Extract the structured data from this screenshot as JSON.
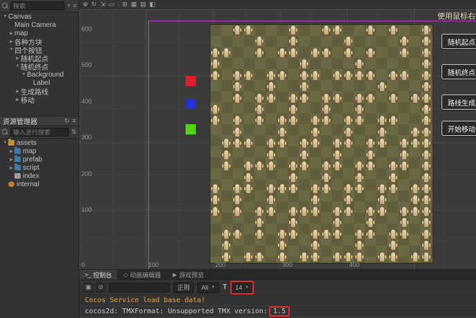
{
  "hierarchy": {
    "search_placeholder": "搜索",
    "items": [
      {
        "label": "Canvas",
        "depth": 0,
        "arrow": "down"
      },
      {
        "label": "Main Camera",
        "depth": 1,
        "arrow": "none"
      },
      {
        "label": "map",
        "depth": 1,
        "arrow": "right"
      },
      {
        "label": "各种方块",
        "depth": 1,
        "arrow": "right"
      },
      {
        "label": "四个按钮",
        "depth": 1,
        "arrow": "down"
      },
      {
        "label": "随机起点",
        "depth": 2,
        "arrow": "right"
      },
      {
        "label": "随机终点",
        "depth": 2,
        "arrow": "down"
      },
      {
        "label": "Background",
        "depth": 3,
        "arrow": "down"
      },
      {
        "label": "Label",
        "depth": 4,
        "arrow": "none"
      },
      {
        "label": "生成路线",
        "depth": 2,
        "arrow": "right"
      },
      {
        "label": "移动",
        "depth": 2,
        "arrow": "right"
      }
    ]
  },
  "assets": {
    "panel_title": "资源管理器",
    "search_placeholder": "输入进行搜索",
    "items": [
      {
        "label": "assets",
        "depth": 0,
        "arrow": "down",
        "icon": "folder-root"
      },
      {
        "label": "map",
        "depth": 1,
        "arrow": "right",
        "icon": "folder"
      },
      {
        "label": "prefab",
        "depth": 1,
        "arrow": "right",
        "icon": "folder"
      },
      {
        "label": "script",
        "depth": 1,
        "arrow": "right",
        "icon": "folder"
      },
      {
        "label": "index",
        "depth": 1,
        "arrow": "none",
        "icon": "file"
      },
      {
        "label": "internal",
        "depth": 0,
        "arrow": "none",
        "icon": "locked"
      }
    ]
  },
  "main_toolbar": {
    "icons": [
      "move-tool-icon",
      "rotate-tool-icon",
      "scale-tool-icon",
      "rect-tool-icon",
      "grid-toggle-icon",
      "layout-toggle-icon",
      "list-view-icon",
      "gizmo-toggle-icon"
    ]
  },
  "scene": {
    "hint_text": "使用鼠标右键",
    "buttons": [
      {
        "label": "随机起点",
        "name": "random-start-button"
      },
      {
        "label": "随机终点",
        "name": "random-end-button"
      },
      {
        "label": "路线生成",
        "name": "route-generate-button"
      },
      {
        "label": "开始移动",
        "name": "start-move-button"
      }
    ],
    "ruler_y": [
      "600",
      "500",
      "400",
      "300",
      "200",
      "100"
    ],
    "ruler_x": [
      "0",
      "100",
      "200",
      "300",
      "400"
    ],
    "blocks": [
      {
        "name": "red-block",
        "color": "#df1b2e"
      },
      {
        "name": "blue-block",
        "color": "#2331dc"
      },
      {
        "name": "green-block",
        "color": "#4fd612"
      }
    ],
    "canvas_border_color": "#c341c3"
  },
  "tilemap": {
    "rows": [
      "..##...#..##..#.#..#",
      "....#..#....#....#.#",
      "##..#.##.##.#.#..#.#",
      "#.......#....#.....#",
      "#.##.##.##.####.##.#",
      "..#..#..#......#...#",
      "..#.##.##.##.##.#.##",
      "#...#..#..#..#.....#",
      "#.#.#.##.##.##.##..#",
      "..#...#..#..#..#..##",
      ".###.##.##.##.##.###",
      ".#...#..#..#..#..#.#",
      ".#.###.##.##.##.##.#",
      "...#...#..#..#..#..#",
      "#.##.###.##.##.##.##",
      "#.#..#...#..#..#..##",
      "#.#.##.###.##.##.###",
      "....#..#...#..#..#.#",
      ".##.#.##.###.##.##.#",
      ".#....#..#...#..#..#",
      ".#.##.#.##.###.##.##"
    ]
  },
  "console": {
    "tabs": [
      {
        "label": "控制台",
        "name": "tab-console",
        "icon": "console-icon",
        "active": true
      },
      {
        "label": "动画编辑器",
        "name": "tab-animation",
        "icon": "animation-icon",
        "active": false
      },
      {
        "label": "游戏预览",
        "name": "tab-preview",
        "icon": "preview-icon",
        "active": false
      }
    ],
    "toolbar_icons": [
      "copy-log-icon",
      "clear-log-icon"
    ],
    "regex_label": "正则",
    "filter_value": "All",
    "font_icon_label": "T",
    "font_size_value": "14",
    "annotation_color": "#de2b2b",
    "logs": [
      {
        "type": "warn",
        "text": "Cocos Service load base data!"
      },
      {
        "type": "plain",
        "text": "cocos2d: TMXFormat: Unsupported TMX version: ",
        "highlight": "1.5"
      }
    ]
  }
}
